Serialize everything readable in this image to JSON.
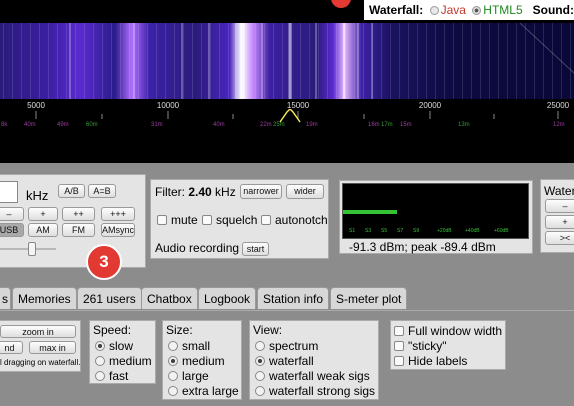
{
  "waterfall_options": {
    "label": "Waterfall:",
    "options": [
      {
        "label": "Java",
        "selected": false,
        "color": "#c0392b"
      },
      {
        "label": "HTML5",
        "selected": true,
        "color": "#1e8a1e"
      }
    ],
    "sound_label": "Sound:"
  },
  "scale": {
    "ticks": [
      "5000",
      "10000",
      "15000",
      "20000",
      "25000"
    ],
    "stations": [
      "8k",
      "40m",
      "49m",
      "60m",
      "4MHz",
      "31m",
      "40m",
      "22m",
      "25m",
      "19m",
      "16m",
      "17m",
      "15m",
      "13m",
      "12m"
    ]
  },
  "frequency_panel": {
    "unit": "kHz",
    "ab_label": "A/B",
    "aeqb_label": "A=B",
    "step_buttons": [
      "–",
      "+",
      "++",
      "+++"
    ],
    "modes": [
      "USB",
      "AM",
      "FM",
      "AMsync"
    ],
    "selected_mode": "USB",
    "badge": "3"
  },
  "filter_panel": {
    "filter_label": "Filter:",
    "filter_value": "2.40",
    "filter_unit": "kHz",
    "narrower_label": "narrower",
    "wider_label": "wider",
    "checks": [
      "mute",
      "squelch",
      "autonotch"
    ],
    "audio_recording_label": "Audio recording",
    "start_label": "start"
  },
  "smeter": {
    "scale": [
      "S1",
      "S3",
      "S5",
      "S7",
      "S9",
      "+20dB",
      "+40dB",
      "+60dB"
    ],
    "readout": "-91.3 dBm; peak  -89.4 dBm",
    "level_fraction": 0.29
  },
  "waterfall_panel": {
    "title": "Water",
    "buttons": [
      "–",
      "+",
      "><"
    ]
  },
  "tabs": [
    "s",
    "Memories",
    "261 users",
    "Chatbox",
    "Logbook",
    "Station info",
    "S-meter plot"
  ],
  "zoom": {
    "zoom_in": "zoom in",
    "nd": "nd",
    "max_in": "max in",
    "hint": "l dragging on waterfall."
  },
  "speed": {
    "title": "Speed:",
    "options": [
      "slow",
      "medium",
      "fast"
    ],
    "selected": "slow"
  },
  "size": {
    "title": "Size:",
    "options": [
      "small",
      "medium",
      "large",
      "extra large"
    ],
    "selected": "medium"
  },
  "view": {
    "title": "View:",
    "options": [
      "spectrum",
      "waterfall",
      "waterfall weak sigs",
      "waterfall strong sigs"
    ],
    "selected": "waterfall"
  },
  "display_flags": [
    "Full window width",
    "\"sticky\"",
    "Hide labels"
  ]
}
